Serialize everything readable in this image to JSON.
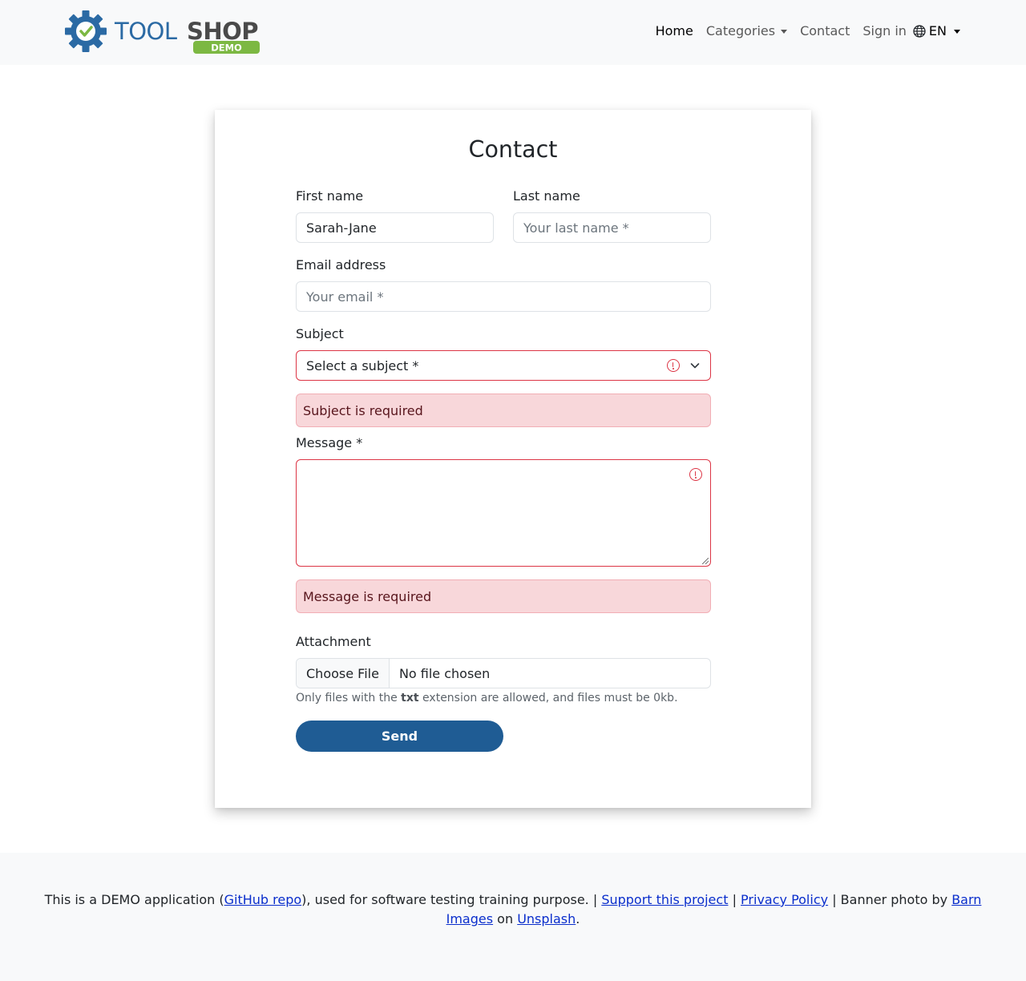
{
  "navbar": {
    "logo_text_1": "TOOL",
    "logo_text_2": "SHOP",
    "logo_badge": "DEMO",
    "links": {
      "home": "Home",
      "categories": "Categories",
      "contact": "Contact",
      "sign_in": "Sign in",
      "language": "EN"
    }
  },
  "contact_form": {
    "title": "Contact",
    "first_name": {
      "label": "First name",
      "value": "Sarah-Jane"
    },
    "last_name": {
      "label": "Last name",
      "placeholder": "Your last name *"
    },
    "email": {
      "label": "Email address",
      "placeholder": "Your email *"
    },
    "subject": {
      "label": "Subject",
      "selected": "Select a subject *",
      "error": "Subject is required"
    },
    "message": {
      "label": "Message *",
      "error": "Message is required"
    },
    "attachment": {
      "label": "Attachment",
      "button": "Choose File",
      "status": "No file chosen",
      "help_prefix": "Only files with the",
      "help_ext": "txt",
      "help_suffix": "extension are allowed, and files must be 0kb."
    },
    "send_label": "Send"
  },
  "footer": {
    "t1": "This is a DEMO application (",
    "github": "GitHub repo",
    "t2": "), used for software testing training purpose. |",
    "support": "Support this project",
    "t3": "|",
    "privacy": "Privacy Policy",
    "t4": "| Banner photo by",
    "barn": "Barn Images",
    "t5": "on",
    "unsplash": "Unsplash",
    "t6": "."
  },
  "colors": {
    "brand_blue": "#1f5c94",
    "logo_blue": "#2b6aa4",
    "logo_gray": "#4a4a4a",
    "logo_green": "#7cb842",
    "error_red": "#dc3545",
    "alert_bg": "#f8d7da"
  }
}
